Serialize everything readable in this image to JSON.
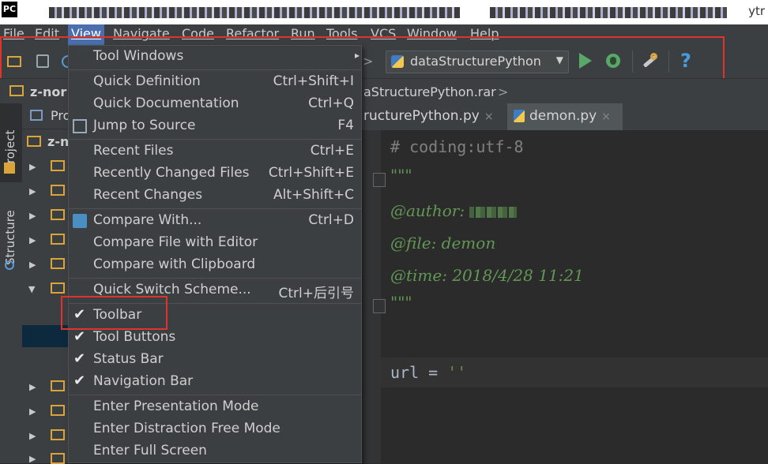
{
  "titlebar": {
    "logo": "PC",
    "right_fragment": "ytr"
  },
  "menubar": [
    "File",
    "Edit",
    "View",
    "Navigate",
    "Code",
    "Refactor",
    "Run",
    "Tools",
    "VCS",
    "Window",
    "Help"
  ],
  "toolbar": {
    "run_config": "dataStructurePython",
    "icons": [
      "open-folder-icon",
      "save-icon",
      "sync-icon",
      "run-icon",
      "debug-icon",
      "settings-wrench-icon",
      "help-icon"
    ],
    "help_symbol": "?"
  },
  "navbar": {
    "project_crumb": "z-nor",
    "file_crumb": "aStructurePython.rar"
  },
  "sidebar": {
    "project_tab": "Project",
    "structure_tab": "Structure",
    "panel_header": "Pro",
    "root": "z-n"
  },
  "tabs": [
    {
      "label": "ructurePython.py",
      "close": "×"
    },
    {
      "label": "demon.py",
      "close": "×"
    }
  ],
  "editor": {
    "line1": "# coding:utf-8",
    "line2": "\"\"\"",
    "line3_prefix": "@author: ",
    "line4": "@file: demon",
    "line5": "@time: 2018/4/28 11:21",
    "line6": "\"\"\"",
    "line7_var": "url = ",
    "line7_str": "''"
  },
  "view_menu": {
    "tool_windows": "Tool Windows",
    "quick_definition": {
      "label": "Quick Definition",
      "shortcut": "Ctrl+Shift+I"
    },
    "quick_documentation": {
      "label": "Quick Documentation",
      "shortcut": "Ctrl+Q"
    },
    "jump_to_source": {
      "label": "Jump to Source",
      "shortcut": "F4"
    },
    "recent_files": {
      "label": "Recent Files",
      "shortcut": "Ctrl+E"
    },
    "recently_changed": {
      "label": "Recently Changed Files",
      "shortcut": "Ctrl+Shift+E"
    },
    "recent_changes": {
      "label": "Recent Changes",
      "shortcut": "Alt+Shift+C"
    },
    "compare_with": {
      "label": "Compare With...",
      "shortcut": "Ctrl+D"
    },
    "compare_file_editor": {
      "label": "Compare File with Editor"
    },
    "compare_clipboard": {
      "label": "Compare with Clipboard"
    },
    "quick_switch": {
      "label": "Quick Switch Scheme...",
      "shortcut": "Ctrl+后引号"
    },
    "toolbar": {
      "label": "Toolbar",
      "checked": true
    },
    "tool_buttons": {
      "label": "Tool Buttons",
      "checked": true
    },
    "status_bar": {
      "label": "Status Bar",
      "checked": true
    },
    "navigation_bar": {
      "label": "Navigation Bar",
      "checked": true
    },
    "presentation": {
      "label": "Enter Presentation Mode"
    },
    "distraction_free": {
      "label": "Enter Distraction Free Mode"
    },
    "full_screen": {
      "label": "Enter Full Screen"
    },
    "check_mark": "✔",
    "submenu_arrow": "▸"
  },
  "colors": {
    "highlight_box": "#e0332b",
    "menu_selected": "#4b6eaf"
  }
}
